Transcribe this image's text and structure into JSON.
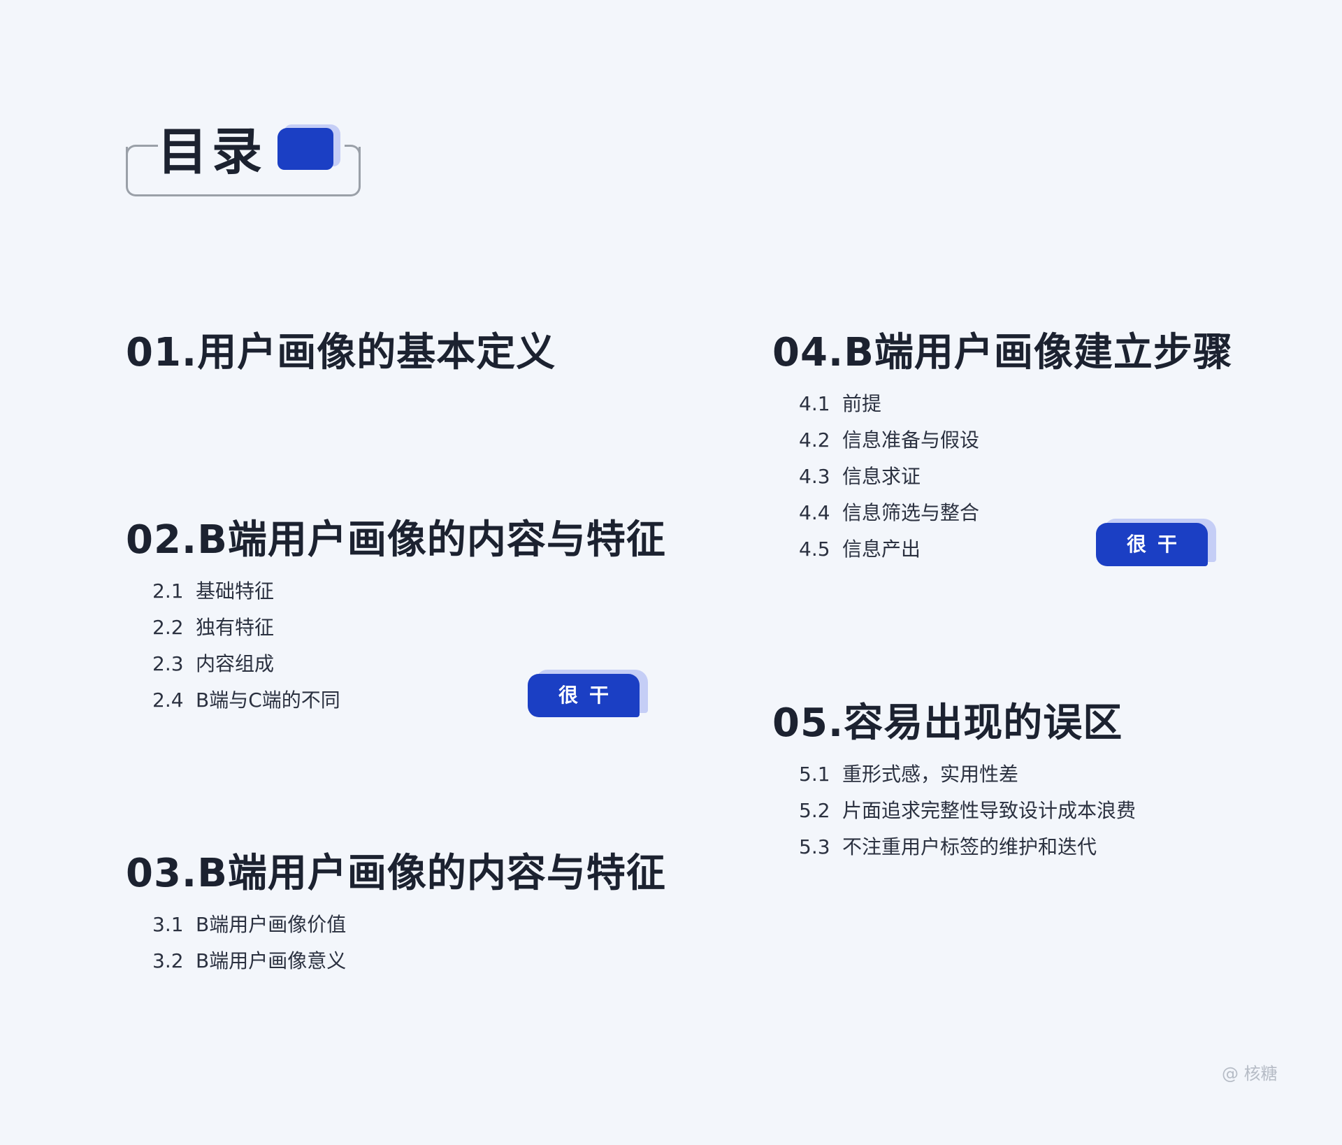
{
  "title": "目录",
  "sections": [
    {
      "heading": "01.用户画像的基本定义",
      "items": []
    },
    {
      "heading": "02.B端用户画像的内容与特征",
      "items": [
        {
          "num": "2.1",
          "label": "基础特征"
        },
        {
          "num": "2.2",
          "label": "独有特征"
        },
        {
          "num": "2.3",
          "label": "内容组成"
        },
        {
          "num": "2.4",
          "label": "B端与C端的不同"
        }
      ]
    },
    {
      "heading": "03.B端用户画像的内容与特征",
      "items": [
        {
          "num": "3.1",
          "label": "B端用户画像价值"
        },
        {
          "num": "3.2",
          "label": "B端用户画像意义"
        }
      ]
    },
    {
      "heading": "04.B端用户画像建立步骤",
      "items": [
        {
          "num": "4.1",
          "label": "前提"
        },
        {
          "num": "4.2",
          "label": "信息准备与假设"
        },
        {
          "num": "4.3",
          "label": "信息求证"
        },
        {
          "num": "4.4",
          "label": "信息筛选与整合"
        },
        {
          "num": "4.5",
          "label": "信息产出"
        }
      ]
    },
    {
      "heading": "05.容易出现的误区",
      "items": [
        {
          "num": "5.1",
          "label": "重形式感，实用性差"
        },
        {
          "num": "5.2",
          "label": "片面追求完整性导致设计成本浪费"
        },
        {
          "num": "5.3",
          "label": "不注重用户标签的维护和迭代"
        }
      ]
    }
  ],
  "tags": {
    "tag_02": "很干",
    "tag_04": "很干"
  },
  "watermark": "@ 核糖",
  "colors": {
    "accent": "#1b3fc4",
    "accent_light": "#c5cef6",
    "background": "#f3f6fb"
  }
}
